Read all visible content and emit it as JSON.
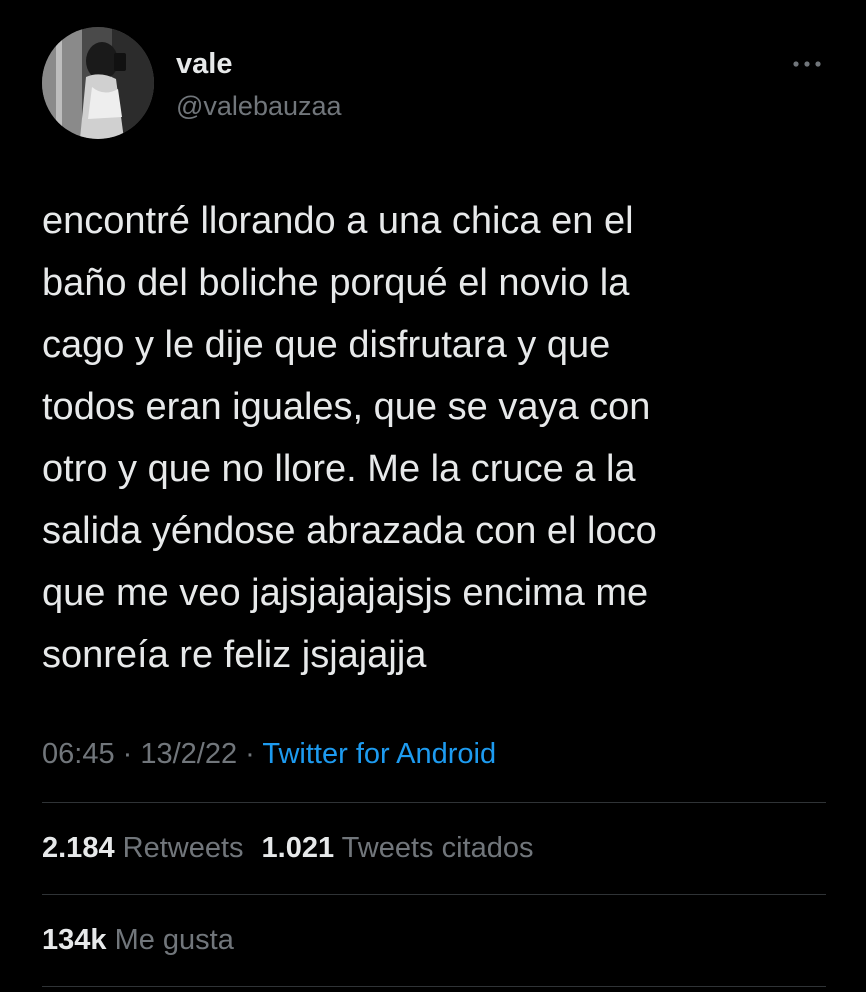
{
  "user": {
    "name": "vale",
    "handle": "@valebauzaa"
  },
  "icons": {
    "avatar": "profile-photo",
    "more": "more-dots-icon"
  },
  "tweet": {
    "text": "encontré llorando a una chica en el\nbaño del boliche porqué el novio la\ncago y le dije que disfrutara y que\ntodos eran iguales, que se vaya con\notro y que no llore. Me la cruce a la\nsalida yéndose abrazada con el loco\nque me veo jajsjajajajsjs encima me\nsonreía re feliz jsjajajja",
    "time": "06:45",
    "separator": " · ",
    "date": "13/2/22",
    "source": "Twitter for Android"
  },
  "stats": {
    "retweets_count": "2.184",
    "retweets_label": "Retweets",
    "quotes_count": "1.021",
    "quotes_label": "Tweets citados",
    "likes_count": "134k",
    "likes_label": "Me gusta"
  },
  "colors": {
    "background": "#000000",
    "primary_text": "#e7e9ea",
    "secondary_text": "#71767b",
    "link": "#1d9bf0",
    "divider": "#2f3336"
  }
}
